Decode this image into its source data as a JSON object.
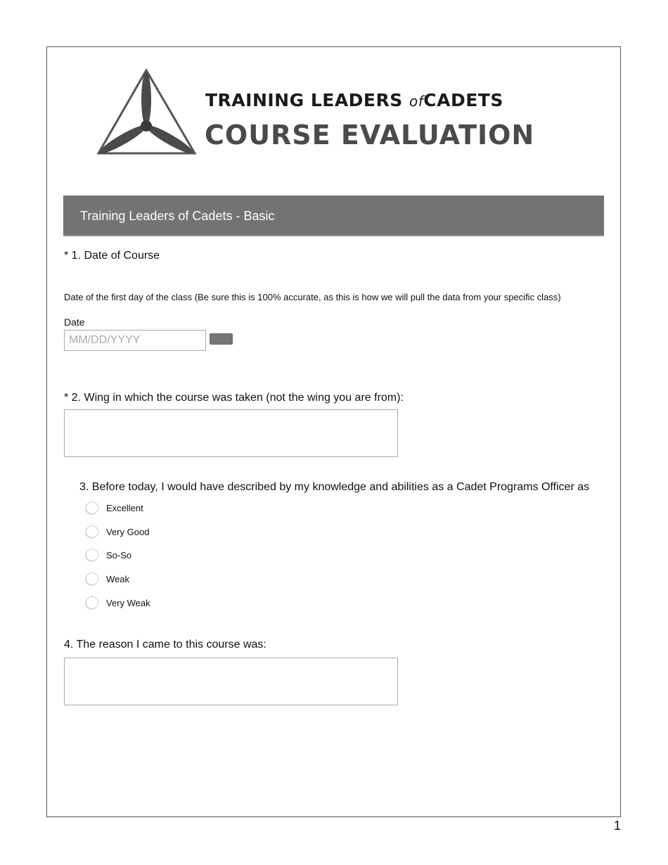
{
  "header": {
    "logo_line1_part1": "TRAINING LEADERS ",
    "logo_line1_of": "of",
    "logo_line1_part2": "CADETS",
    "logo_line2": "COURSE EVALUATION",
    "logo_icon": "propeller-triangle-icon"
  },
  "section": {
    "title": "Training Leaders of Cadets - Basic",
    "bar_color": "#737373"
  },
  "questions": {
    "q1": {
      "title": "* 1. Date of  Course",
      "description": "Date of the first day of the class (Be sure this is 100% accurate, as this is how we will pull the data from your specific class)",
      "field_label": "Date",
      "placeholder": "MM/DD/YYYY",
      "value": ""
    },
    "q2": {
      "title": "* 2. Wing in which the course was taken (not the wing you are from):",
      "value": ""
    },
    "q3": {
      "title": "3. Before today, I would have described by my knowledge and abilities as a Cadet Programs Officer as",
      "options": [
        {
          "label": "Excellent",
          "selected": false
        },
        {
          "label": "Very Good",
          "selected": false
        },
        {
          "label": "So-So",
          "selected": false
        },
        {
          "label": "Weak",
          "selected": false
        },
        {
          "label": "Very Weak",
          "selected": false
        }
      ]
    },
    "q4": {
      "title": "4. The reason I came to this course was:",
      "value": ""
    }
  },
  "footer": {
    "page_number": "1"
  }
}
